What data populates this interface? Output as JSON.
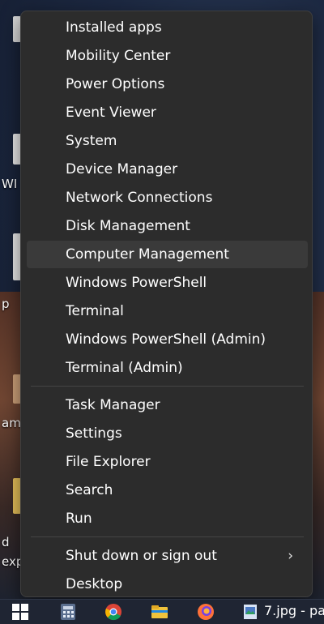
{
  "menu": {
    "group1": [
      {
        "label": "Installed apps"
      },
      {
        "label": "Mobility Center"
      },
      {
        "label": "Power Options"
      },
      {
        "label": "Event Viewer"
      },
      {
        "label": "System"
      },
      {
        "label": "Device Manager"
      },
      {
        "label": "Network Connections"
      },
      {
        "label": "Disk Management"
      },
      {
        "label": "Computer Management"
      },
      {
        "label": "Windows PowerShell"
      },
      {
        "label": "Terminal"
      },
      {
        "label": "Windows PowerShell (Admin)"
      },
      {
        "label": "Terminal (Admin)"
      }
    ],
    "group2": [
      {
        "label": "Task Manager"
      },
      {
        "label": "Settings"
      },
      {
        "label": "File Explorer"
      },
      {
        "label": "Search"
      },
      {
        "label": "Run"
      }
    ],
    "group3": [
      {
        "label": "Shut down or sign out",
        "submenu_icon": "chevron-right-icon"
      },
      {
        "label": "Desktop"
      }
    ],
    "hovered_item": "Computer Management"
  },
  "desktop": {
    "labels": [
      "WI",
      "p",
      "am",
      "d",
      "exp"
    ]
  },
  "taskbar": {
    "icons": [
      "windows-start-icon",
      "calculator-icon",
      "chrome-icon",
      "file-explorer-icon",
      "firefox-icon",
      "image-file-icon"
    ],
    "active_window_label": "7.jpg - pa"
  },
  "colors": {
    "menu_bg": "#2c2c2c",
    "hover_bg": "#3a3a3a",
    "text": "#ffffff",
    "separator": "#454545"
  }
}
